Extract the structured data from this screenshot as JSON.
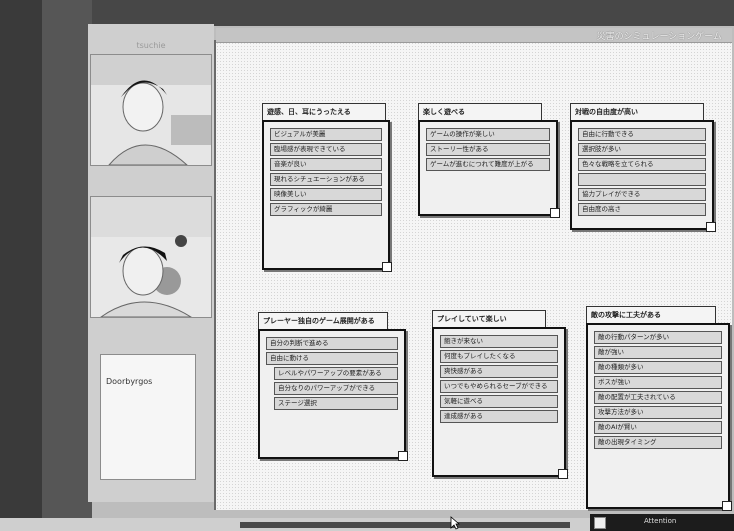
{
  "window": {
    "title": "災害のシミュレーションゲーム"
  },
  "video_panel": {
    "feed1_label": "tsuchie",
    "feed2_label": "",
    "chat_title": "",
    "chat_text": "Doorbyrgos"
  },
  "cards": [
    {
      "title": "遊感、日、耳にうったえる",
      "items": [
        {
          "text": "ビジュアルが美麗",
          "cls": ""
        },
        {
          "text": "臨場感が表現できている",
          "cls": ""
        },
        {
          "text": "音楽が良い",
          "cls": ""
        },
        {
          "text": "現れるシチュエーションがある",
          "cls": ""
        },
        {
          "text": "映像美しい",
          "cls": ""
        },
        {
          "text": "グラフィックが綺麗",
          "cls": ""
        }
      ]
    },
    {
      "title": "楽しく遊べる",
      "items": [
        {
          "text": "ゲームの操作が楽しい",
          "cls": ""
        },
        {
          "text": "ストーリー性がある",
          "cls": ""
        },
        {
          "text": "ゲームが進むにつれて難度が上がる",
          "cls": "wrap"
        }
      ]
    },
    {
      "title": "対戦の自由度が高い",
      "items": [
        {
          "text": "自由に行動できる",
          "cls": ""
        },
        {
          "text": "選択肢が多い",
          "cls": ""
        },
        {
          "text": "色々な戦略を立てられる",
          "cls": ""
        },
        {
          "text": "",
          "cls": ""
        },
        {
          "text": "協力プレイができる",
          "cls": ""
        },
        {
          "text": "自由度の高さ",
          "cls": ""
        }
      ]
    },
    {
      "title": "プレーヤー独自のゲーム展開がある",
      "items": [
        {
          "text": "自分の判断で進める",
          "cls": ""
        },
        {
          "text": "自由に動ける",
          "cls": ""
        },
        {
          "text": "レベルやパワーアップの要素がある",
          "cls": "wrap indent"
        },
        {
          "text": "自分なりのパワーアップができる",
          "cls": "wrap indent"
        },
        {
          "text": "ステージ選択",
          "cls": "indent"
        }
      ]
    },
    {
      "title": "プレイしていて楽しい",
      "items": [
        {
          "text": "飽きが来ない",
          "cls": ""
        },
        {
          "text": "何度もプレイしたくなる",
          "cls": ""
        },
        {
          "text": "爽快感がある",
          "cls": ""
        },
        {
          "text": "いつでもやめられるセーブができる",
          "cls": "wrap"
        },
        {
          "text": "気軽に遊べる",
          "cls": ""
        },
        {
          "text": "達成感がある",
          "cls": ""
        }
      ]
    },
    {
      "title": "敵の攻撃に工夫がある",
      "items": [
        {
          "text": "敵の行動パターンが多い",
          "cls": ""
        },
        {
          "text": "敵が強い",
          "cls": "wrap"
        },
        {
          "text": "敵の種類が多い",
          "cls": ""
        },
        {
          "text": "ボスが強い",
          "cls": ""
        },
        {
          "text": "敵の配置が工夫されている",
          "cls": ""
        },
        {
          "text": "攻撃方法が多い",
          "cls": ""
        },
        {
          "text": "敵のAIが賢い",
          "cls": "wrap"
        },
        {
          "text": "敵の出現タイミング",
          "cls": "wrap"
        }
      ]
    }
  ],
  "taskbar": {
    "text": "Attention"
  }
}
